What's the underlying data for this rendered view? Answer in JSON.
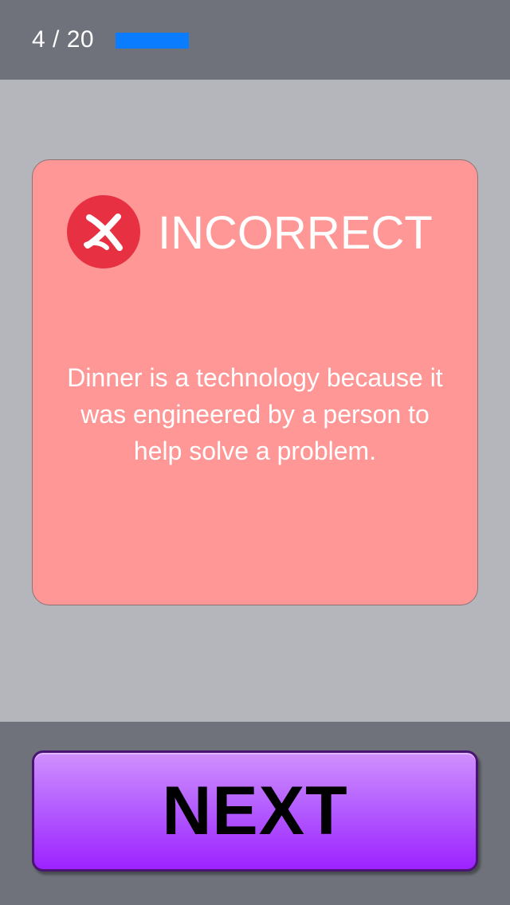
{
  "header": {
    "progress_text": "4 / 20",
    "progress_fraction": 0.2,
    "progress_color": "#0a7cff"
  },
  "feedback": {
    "status_icon": "x-circle-icon",
    "title": "INCORRECT",
    "explanation": "Dinner is a technology because it was engineered by a person to help solve a problem.",
    "card_color": "#fe9796",
    "icon_color": "#e83043"
  },
  "footer": {
    "next_label": "NEXT",
    "button_color": "#b560ff"
  }
}
